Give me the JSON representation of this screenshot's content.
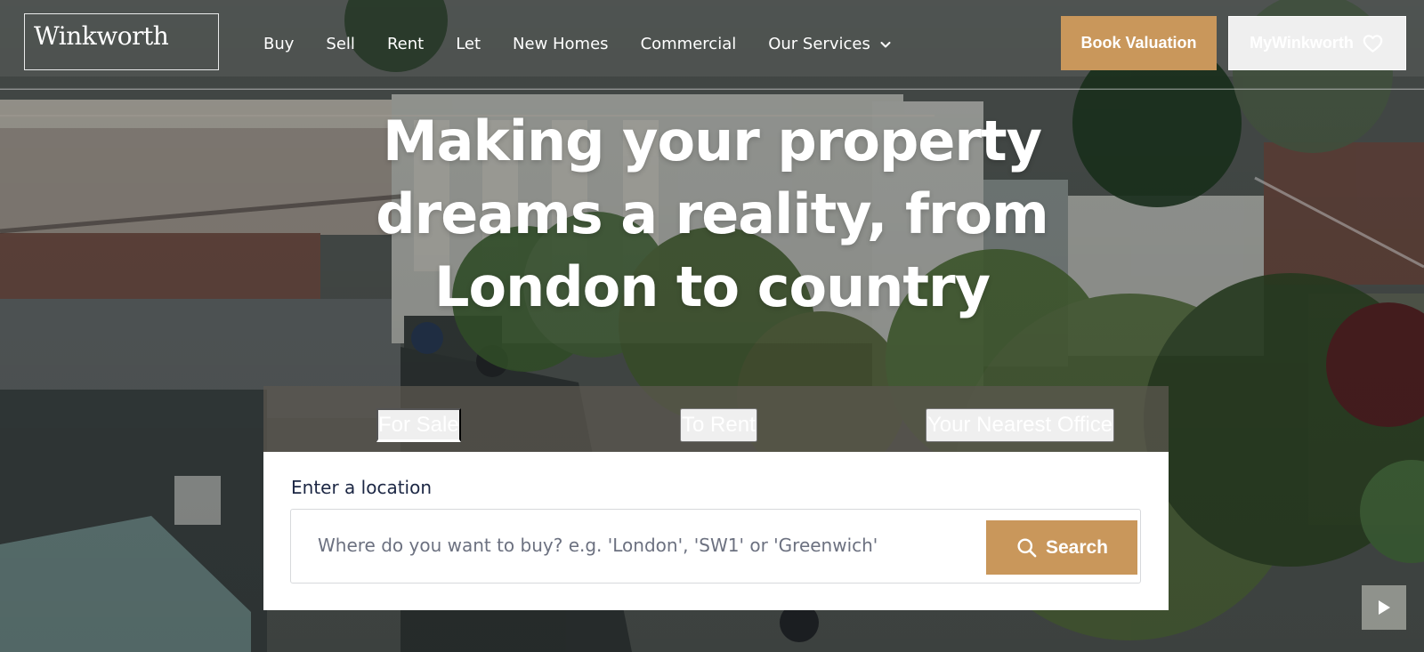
{
  "header": {
    "logo_text": "Winkworth",
    "nav": [
      {
        "label": "Buy"
      },
      {
        "label": "Sell"
      },
      {
        "label": "Rent"
      },
      {
        "label": "Let"
      },
      {
        "label": "New Homes"
      },
      {
        "label": "Commercial"
      },
      {
        "label": "Our Services"
      }
    ],
    "book_valuation_label": "Book Valuation",
    "my_winkworth_label": "MyWinkworth"
  },
  "hero": {
    "headline_lines": [
      "Making your property",
      "dreams a reality, from",
      "London to country"
    ]
  },
  "search": {
    "tabs": [
      {
        "label": "For Sale",
        "active": true
      },
      {
        "label": "To Rent",
        "active": false
      },
      {
        "label": "Your Nearest Office",
        "active": false
      }
    ],
    "location_label": "Enter a location",
    "placeholder": "Where do you want to buy? e.g. 'London', 'SW1' or 'Greenwich'",
    "button_label": "Search"
  },
  "colors": {
    "accent": "#c9975b",
    "text_dark": "#1c2744",
    "white": "#ffffff"
  },
  "icons": {
    "chevron": "chevron-down-icon",
    "heart": "heart-icon",
    "search": "search-icon",
    "play": "play-icon"
  }
}
